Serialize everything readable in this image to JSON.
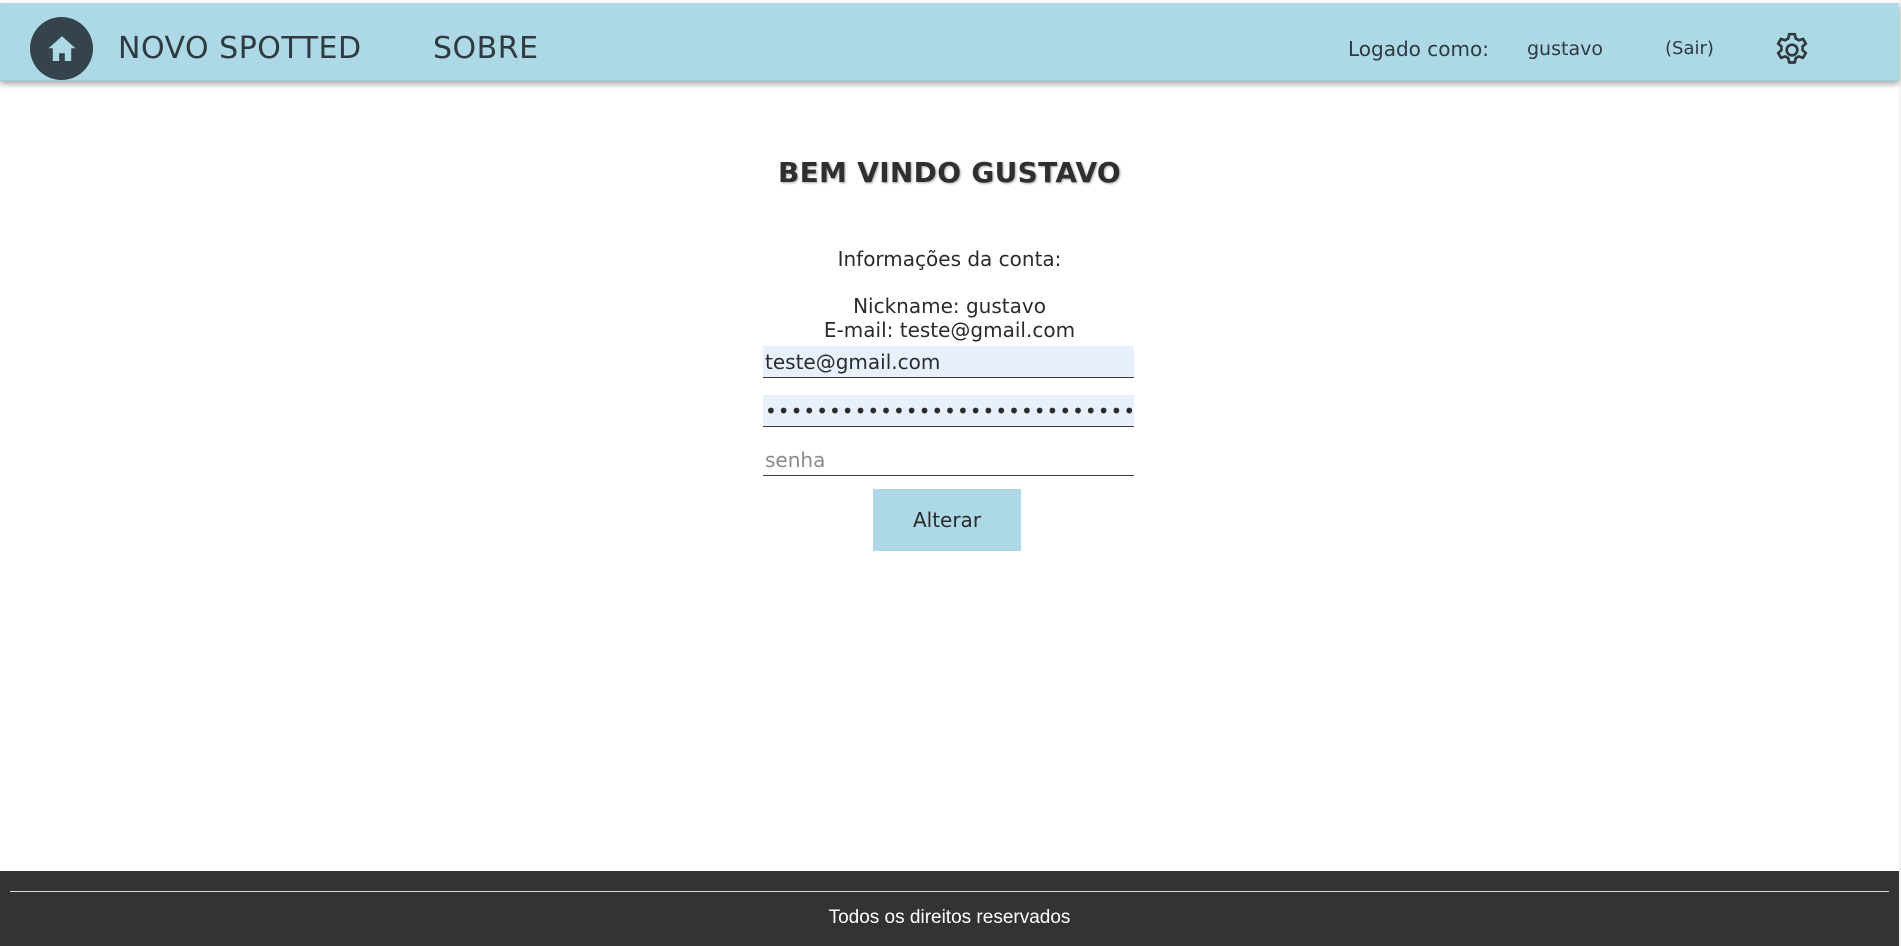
{
  "header": {
    "home_icon": "home-icon",
    "nav": {
      "novo_spotted": "NOVO SPOTTED",
      "sobre": "SOBRE"
    },
    "user": {
      "logged_label": "Logado como:",
      "username": "gustavo",
      "logout": "(Sair)"
    },
    "settings_icon": "gear-icon",
    "background_color": "#add8e6"
  },
  "main": {
    "welcome": "BEM VINDO GUSTAVO",
    "info_title": "Informações da conta:",
    "nickname_line": "Nickname: gustavo",
    "email_line": "E-mail: teste@gmail.com",
    "form": {
      "email_value": "teste@gmail.com",
      "password_value": "•••••••••••••••••••••••••••••••",
      "new_password_placeholder": "senha",
      "submit_label": "Alterar"
    }
  },
  "footer": {
    "text": "Todos os direitos reservados",
    "background_color": "#333333"
  }
}
